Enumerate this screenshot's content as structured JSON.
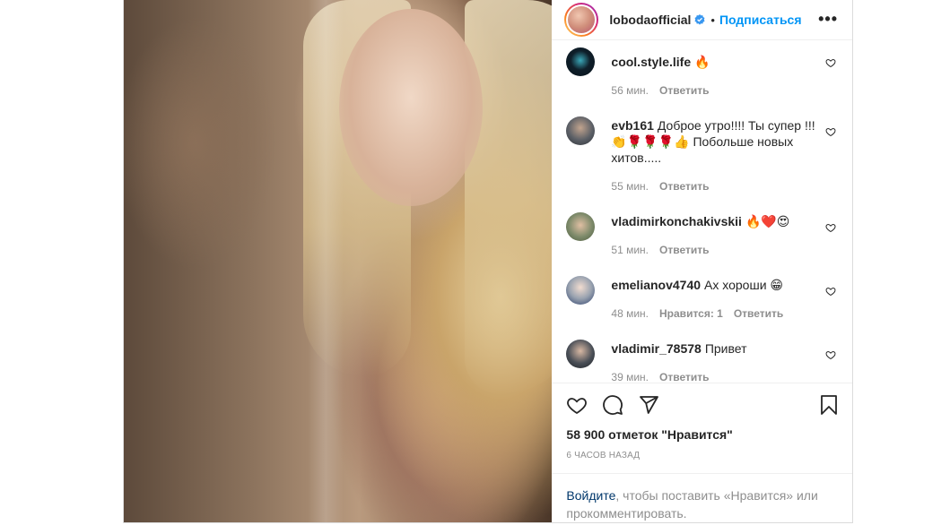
{
  "post": {
    "username": "lobodaofficial",
    "separator": "•",
    "follow_label": "Подписаться",
    "more_label": "•••"
  },
  "comments": [
    {
      "user": "cool.style.life",
      "text": "🔥",
      "time": "56 мин.",
      "likes": "",
      "reply": "Ответить",
      "avatar_color": "#0f1f2a"
    },
    {
      "user": "evb161",
      "text": "Доброе утро!!!! Ты супер !!! 👏🌹🌹🌹👍 Побольше новых хитов.....",
      "time": "55 мин.",
      "likes": "",
      "reply": "Ответить",
      "avatar_color": "#5b5f66"
    },
    {
      "user": "vladimirkonchakivskii",
      "text": "🔥❤️😍",
      "time": "51 мин.",
      "likes": "",
      "reply": "Ответить",
      "avatar_color": "#7d8a6a"
    },
    {
      "user": "emelianov4740",
      "text": "Ах хороши 😁",
      "time": "48 мин.",
      "likes": "Нравится: 1",
      "reply": "Ответить",
      "avatar_color": "#9aa3b0"
    },
    {
      "user": "vladimir_78578",
      "text": "Привет",
      "time": "39 мин.",
      "likes": "",
      "reply": "Ответить",
      "avatar_color": "#4a4f57"
    }
  ],
  "actions": {
    "like_icon": "heart-icon",
    "comment_icon": "comment-icon",
    "share_icon": "share-icon",
    "save_icon": "bookmark-icon"
  },
  "likes_text": "58 900 отметок \"Нравится\"",
  "time_text": "6 ЧАСОВ НАЗАД",
  "login": {
    "link_text": "Войдите",
    "rest_text": ", чтобы поставить «Нравится» или прокомментировать."
  },
  "colors": {
    "accent": "#0095f6",
    "verified": "#3897f0",
    "muted": "#8e8e8e"
  }
}
